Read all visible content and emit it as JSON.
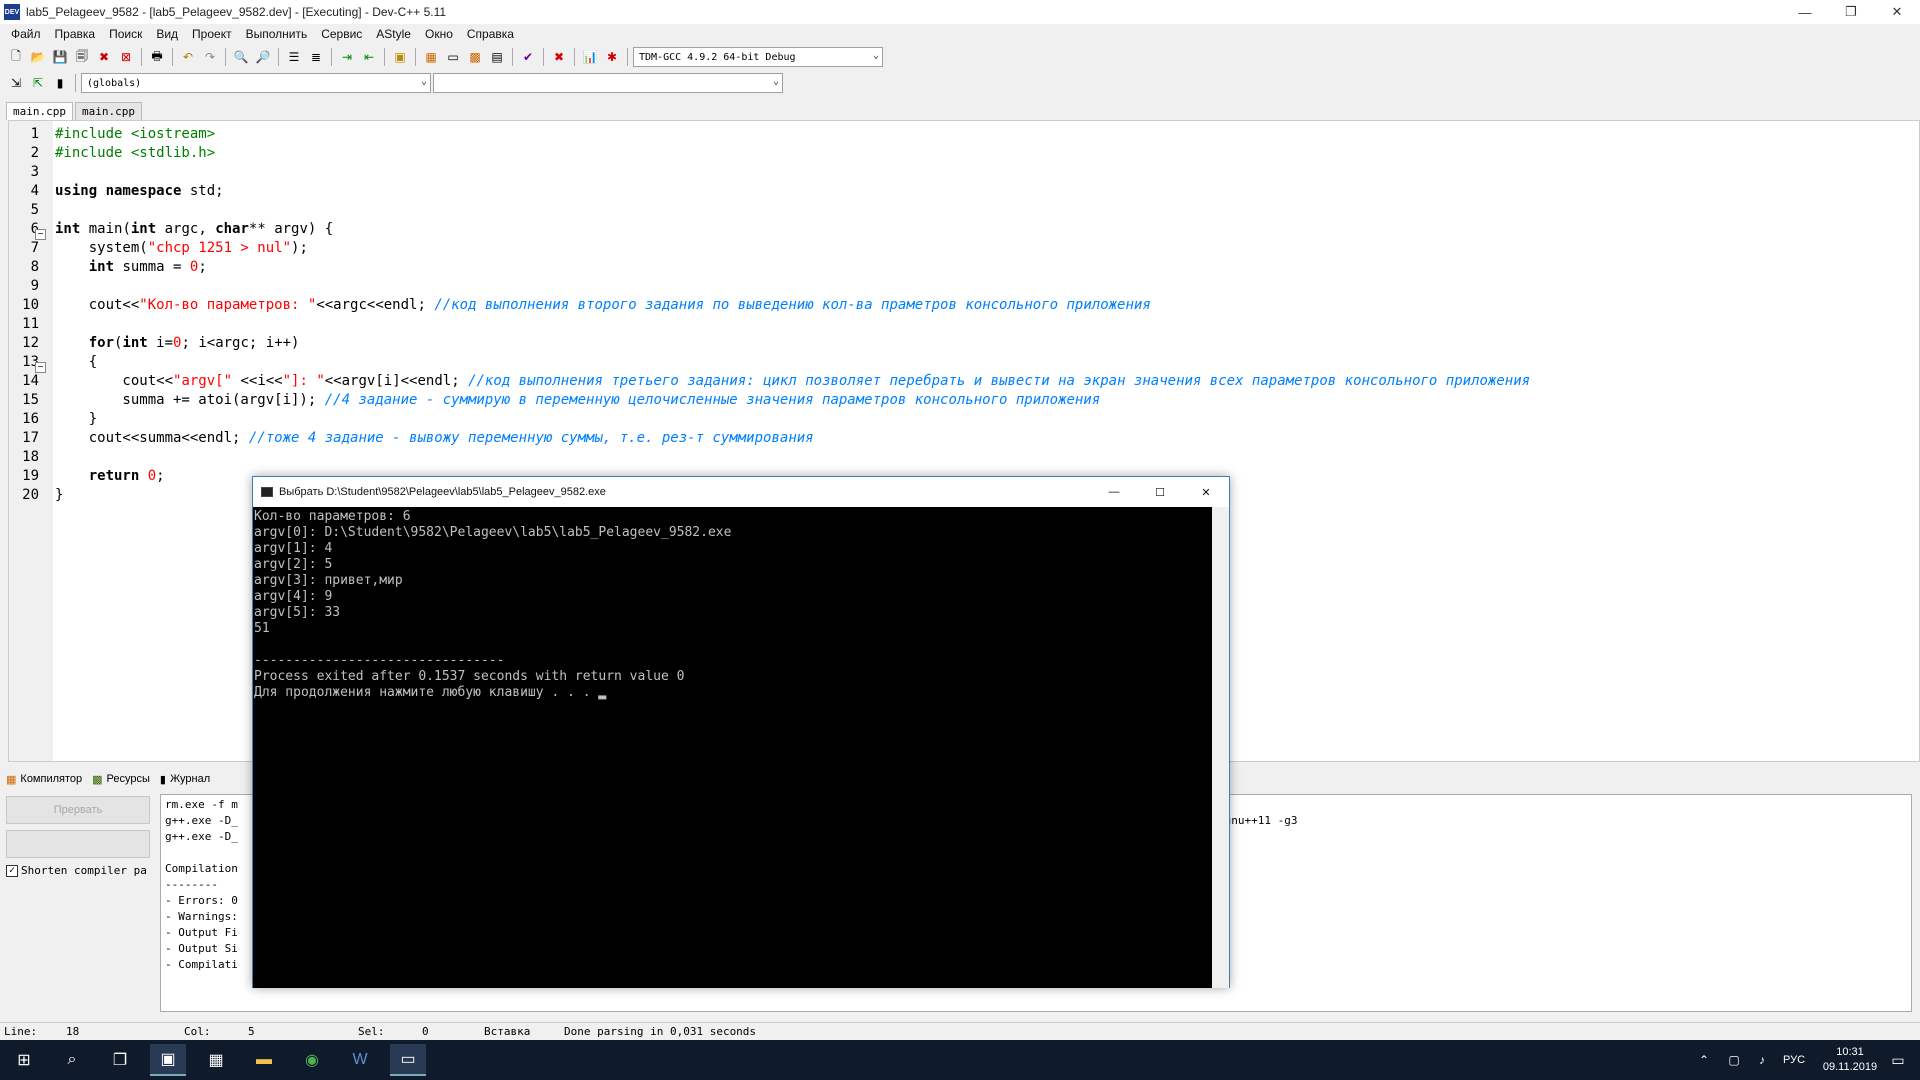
{
  "window": {
    "title": "lab5_Pelageev_9582 - [lab5_Pelageev_9582.dev] - [Executing] - Dev-C++ 5.11",
    "app_icon": "DEV",
    "minimize": "—",
    "restore": "❐",
    "close": "✕"
  },
  "menu": [
    "Файл",
    "Правка",
    "Поиск",
    "Вид",
    "Проект",
    "Выполнить",
    "Сервис",
    "AStyle",
    "Окно",
    "Справка"
  ],
  "toolbar": {
    "compiler": "TDM-GCC 4.9.2 64-bit Debug",
    "scope": "(globals)",
    "members": ""
  },
  "tabs": [
    "main.cpp",
    "main.cpp"
  ],
  "editor": {
    "lines": [
      "1",
      "2",
      "3",
      "4",
      "5",
      "6",
      "7",
      "8",
      "9",
      "10",
      "11",
      "12",
      "13",
      "14",
      "15",
      "16",
      "17",
      "18",
      "19",
      "20"
    ],
    "fold_minus": "−",
    "code": {
      "l1": "#include <iostream>",
      "l2": "#include <stdlib.h>",
      "l4a": "using namespace",
      "l4b": " std;",
      "l6a": "int",
      "l6b": " main(",
      "l6c": "int",
      "l6d": " argc, ",
      "l6e": "char",
      "l6f": "** argv) {",
      "l7a": "    system(",
      "l7b": "\"chcp 1251 > nul\"",
      "l7c": ");",
      "l8a": "    ",
      "l8b": "int",
      "l8c": " summa = ",
      "l8d": "0",
      "l8e": ";",
      "l10a": "    cout<<",
      "l10b": "\"Кол-во параметров: \"",
      "l10c": "<<argc<<endl; ",
      "l10d": "//код выполнения второго задания по выведению кол-ва праметров консольного приложения",
      "l12a": "    ",
      "l12b": "for",
      "l12c": "(",
      "l12d": "int",
      "l12e": " i=",
      "l12f": "0",
      "l12g": "; i<argc; i++)",
      "l13": "    {",
      "l14a": "        cout<<",
      "l14b": "\"argv[\"",
      "l14c": " <<i<<",
      "l14d": "\"]: \"",
      "l14e": "<<argv[i]<<endl; ",
      "l14f": "//код выполнения третьего задания: цикл позволяет перебрать и вывести на экран значения всех параметров консольного приложения",
      "l15a": "        summa += atoi(argv[i]); ",
      "l15b": "//4 задание - суммирую в переменную целочисленные значения параметров консольного приложения",
      "l16": "    }",
      "l17a": "    cout<<summa<<endl; ",
      "l17b": "//тоже 4 задание - вывожу переменную суммы, т.е. рез-т суммирования",
      "l19a": "    ",
      "l19b": "return",
      "l19c": " ",
      "l19d": "0",
      "l19e": ";",
      "l20": "}"
    }
  },
  "bottom_tabs": [
    "Компилятор",
    "Ресурсы",
    "Журнал"
  ],
  "left_panel": {
    "abort": "Прервать",
    "shorten": "Shorten compiler pa",
    "checkmark": "✓"
  },
  "compile_log": "rm.exe -f m\ng++.exe -D_                                                                                                                                                   d=gnu++11 -g3\ng++.exe -D_\n\nCompilation\n--------\n- Errors: 0\n- Warnings:\n- Output Fi\n- Output Si\n- Compilati",
  "console": {
    "title": "Выбрать D:\\Student\\9582\\Pelageev\\lab5\\lab5_Pelageev_9582.exe",
    "output": "Кол-во параметров: 6\nargv[0]: D:\\Student\\9582\\Pelageev\\lab5\\lab5_Pelageev_9582.exe\nargv[1]: 4\nargv[2]: 5\nargv[3]: привет,мир\nargv[4]: 9\nargv[5]: 33\n51\n\n--------------------------------\nProcess exited after 0.1537 seconds with return value 0\nДля продолжения нажмите любую клавишу . . . ▂"
  },
  "status": {
    "line_label": "Line:",
    "line": "18",
    "col_label": "Col:",
    "col": "5",
    "sel_label": "Sel:",
    "sel": "0",
    "mode": "Вставка",
    "msg": "Done parsing in 0,031 seconds"
  },
  "taskbar": {
    "lang": "РУС",
    "time": "10:31",
    "date": "09.11.2019"
  }
}
